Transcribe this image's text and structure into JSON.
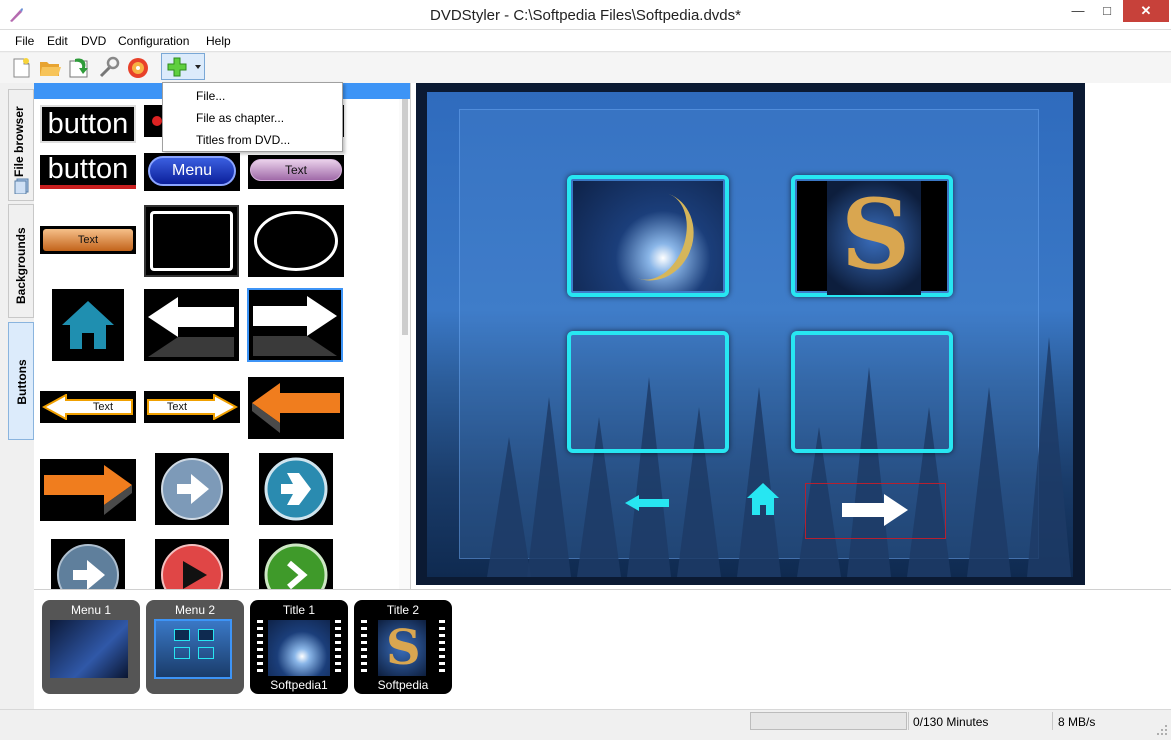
{
  "window": {
    "title": "DVDStyler - C:\\Softpedia Files\\Softpedia.dvds*",
    "minimize": "—",
    "maximize": "□",
    "close": "✕"
  },
  "menu": [
    "File",
    "Edit",
    "DVD",
    "Configuration",
    "Help"
  ],
  "toolbar": {
    "icons": [
      "new-document-icon",
      "open-folder-icon",
      "save-icon",
      "settings-wrench-icon",
      "burn-disc-icon",
      "add-icon"
    ]
  },
  "dropdown": {
    "items": [
      "File...",
      "File as chapter...",
      "Titles from DVD..."
    ]
  },
  "sidetabs": [
    "File browser",
    "Backgrounds",
    "Buttons"
  ],
  "button_gallery": {
    "big1": "button",
    "big2": "button",
    "menu": "Menu",
    "text1": "Text",
    "text2": "Text",
    "text3": "Text",
    "text4": "Text"
  },
  "titleset": [
    {
      "label": "Menu 1",
      "sublabel": ""
    },
    {
      "label": "Menu 2",
      "sublabel": ""
    },
    {
      "label": "Title 1",
      "sublabel": "Softpedia1"
    },
    {
      "label": "Title 2",
      "sublabel": "Softpedia"
    }
  ],
  "status": {
    "progress_fraction": 0,
    "minutes": "0/130 Minutes",
    "bitrate": "8 MB/s"
  },
  "colors": {
    "accent": "#3d94f6",
    "frame_cyan": "#27e6f2",
    "orange": "#f07d1e"
  }
}
